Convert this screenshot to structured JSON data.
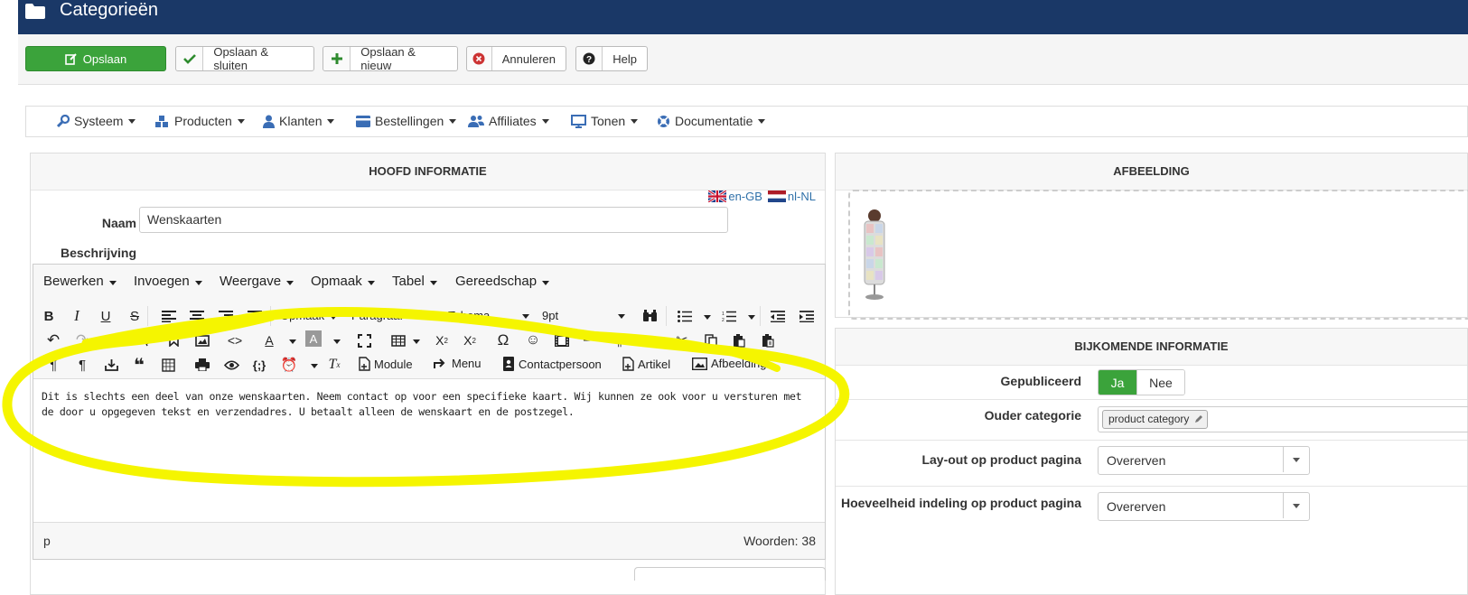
{
  "header": {
    "title": "Categorieën"
  },
  "toolbar": {
    "save": "Opslaan",
    "save_close": "Opslaan & sluiten",
    "save_new": "Opslaan & nieuw",
    "cancel": "Annuleren",
    "help": "Help"
  },
  "nav": {
    "items": [
      {
        "label": "Systeem",
        "icon": "wrench-icon"
      },
      {
        "label": "Producten",
        "icon": "cubes-icon"
      },
      {
        "label": "Klanten",
        "icon": "user-icon"
      },
      {
        "label": "Bestellingen",
        "icon": "credit-card-icon"
      },
      {
        "label": "Affiliates",
        "icon": "users-icon"
      },
      {
        "label": "Tonen",
        "icon": "monitor-icon"
      },
      {
        "label": "Documentatie",
        "icon": "lifebuoy-icon"
      }
    ]
  },
  "main": {
    "heading": "HOOFD INFORMATIE",
    "lang_en": "en-GB",
    "lang_nl": "nl-NL",
    "name_label": "Naam",
    "name_value": "Wenskaarten",
    "desc_label": "Beschrijving"
  },
  "editor": {
    "menus": [
      "Bewerken",
      "Invoegen",
      "Weergave",
      "Opmaak",
      "Tabel",
      "Gereedschap"
    ],
    "format_select": "Opmaak",
    "block_select": "Paragraaf",
    "font_select": "Tahoma",
    "size_select": "9pt",
    "btn_module": "Module",
    "btn_menu": "Menu",
    "btn_contact": "Contactpersoon",
    "btn_article": "Artikel",
    "btn_image": "Afbeelding",
    "content": "Dit is slechts een deel van onze wenskaarten. Neem contact op voor een specifieke kaart. Wij kunnen ze ook voor u versturen met de door u opgegeven tekst en verzendadres. U betaalt alleen de wenskaart en de postzegel.",
    "path": "p",
    "word_count": "Woorden: 38"
  },
  "image_panel": {
    "heading": "AFBEELDING"
  },
  "info_panel": {
    "heading": "BIJKOMENDE INFORMATIE",
    "published_label": "Gepubliceerd",
    "yes": "Ja",
    "no": "Nee",
    "parent_label": "Ouder categorie",
    "parent_tag": "product category",
    "layout_label": "Lay-out op product pagina",
    "layout_value": "Overerven",
    "quantity_label": "Hoeveelheid indeling op product pagina",
    "quantity_value": "Overerven"
  },
  "colors": {
    "header_bg": "#1a3867",
    "save_green": "#3ba33b",
    "highlight_yellow": "#f5f500",
    "link_blue": "#3071a9"
  }
}
